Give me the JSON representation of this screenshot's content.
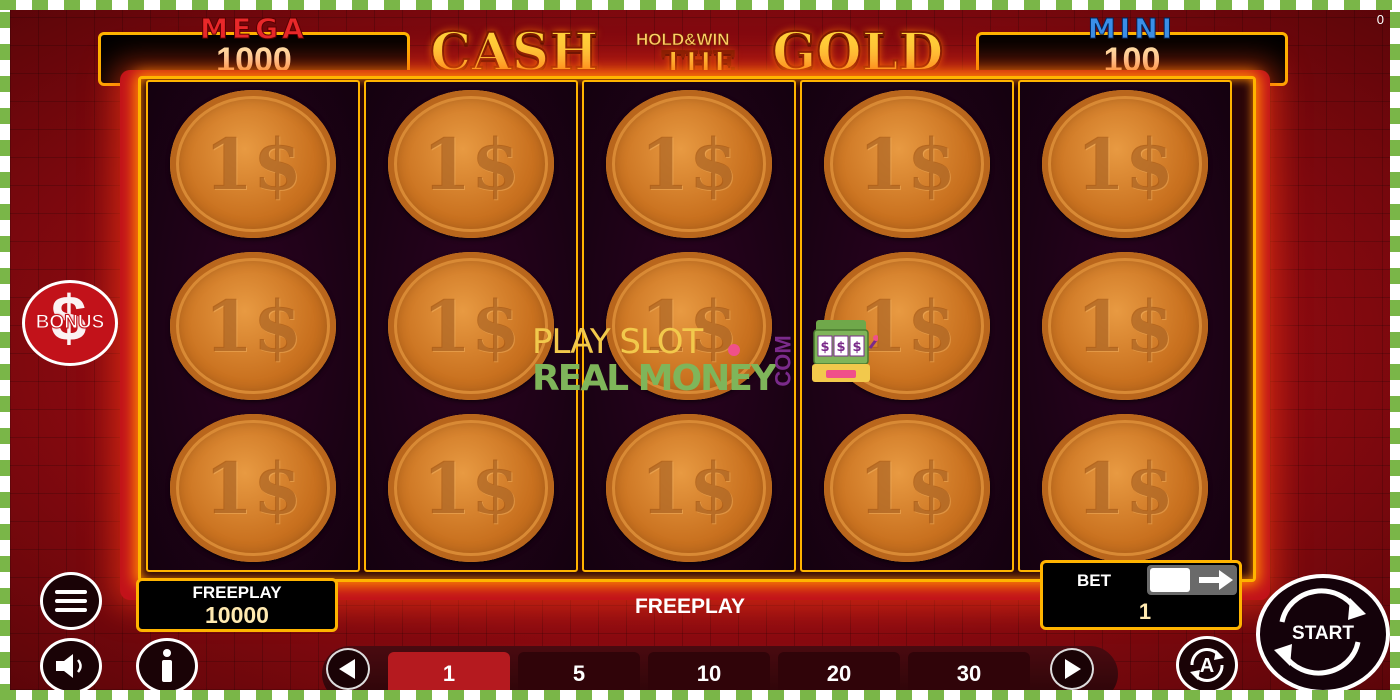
{
  "game": {
    "title_line1": "CASH",
    "title_holdwin": "HOLD&WIN",
    "title_the": "THE",
    "title_line2": "GOLD",
    "corner_counter": "0"
  },
  "jackpots": {
    "mega": {
      "label": "MEGA",
      "value": "1000",
      "label_color": "#e8282a"
    },
    "mini": {
      "label": "MINI",
      "value": "100",
      "label_color": "#3a8fe8"
    }
  },
  "reels": {
    "columns": 5,
    "rows": 3,
    "symbol": "coin-symbol",
    "symbol_glyph": "1$"
  },
  "bonus_button": {
    "label": "BONUS",
    "icon": "dollar-icon"
  },
  "watermark": {
    "line1": "PLAY SLOT",
    "line2": "REAL MONEY",
    "suffix": "COM",
    "icon": "slot-machine-icon"
  },
  "freeplay_box": {
    "label": "FREEPLAY",
    "value": "10000"
  },
  "status_text": "FREEPLAY",
  "bet": {
    "label": "BET",
    "value": "1"
  },
  "bet_options": {
    "values": [
      "1",
      "5",
      "10",
      "20",
      "30"
    ],
    "selected": "1"
  },
  "buttons": {
    "menu": "menu-icon",
    "sound": "speaker-icon",
    "info": "info-icon",
    "autoplay": "autoplay-icon",
    "start_label": "START"
  },
  "colors": {
    "accent_gold": "#ffb400",
    "background_red": "#8a0a10",
    "coin_gold": "#c9711f",
    "active_bet": "#b51a1f"
  }
}
